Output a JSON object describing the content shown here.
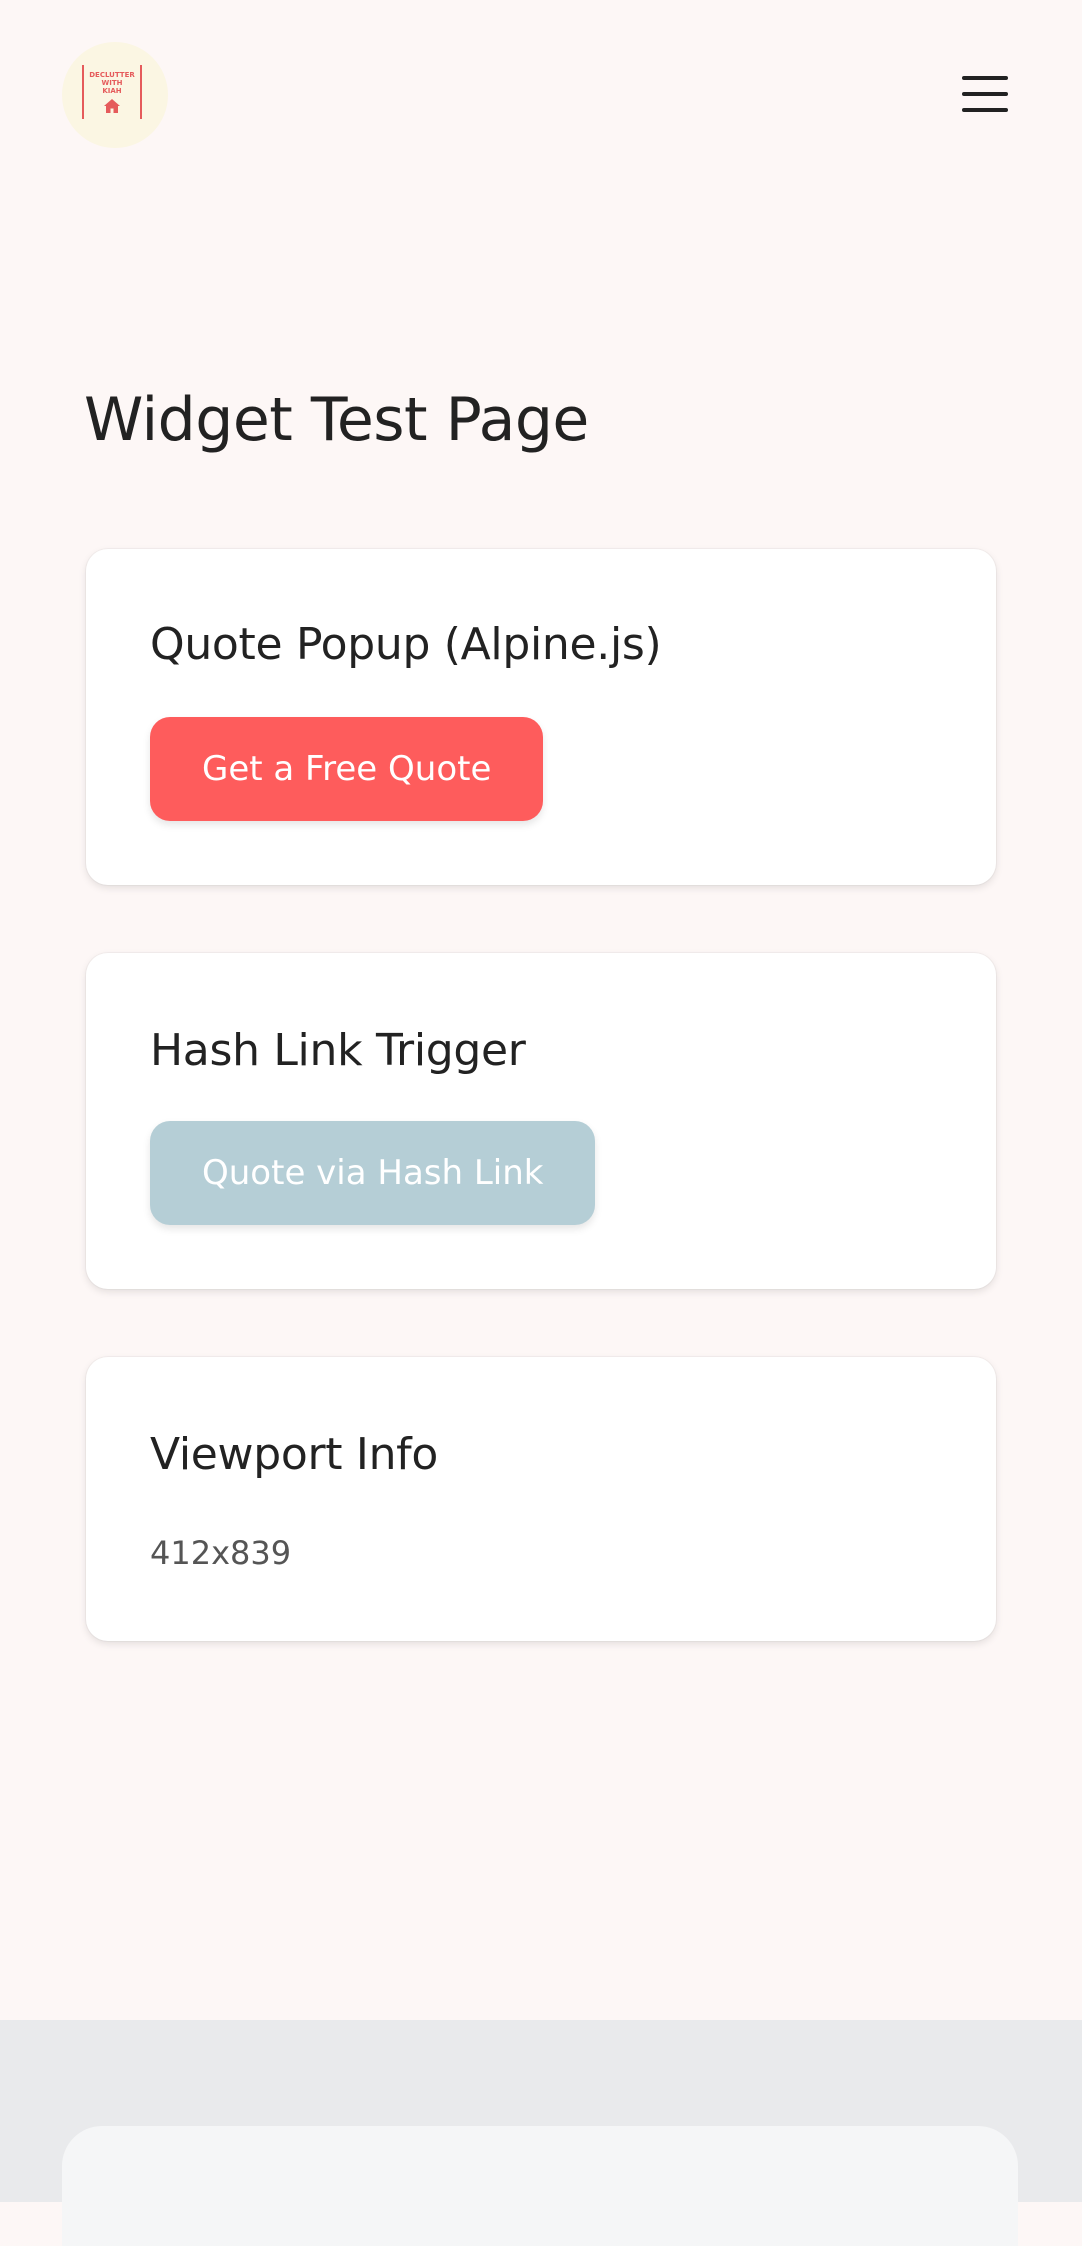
{
  "header": {
    "logo_text": "DECLUTTER\nWITH\nKIAH",
    "logo_icon": "house-icon",
    "menu_icon": "hamburger-menu-icon"
  },
  "page": {
    "title": "Widget Test Page"
  },
  "cards": [
    {
      "title": "Quote Popup (Alpine.js)",
      "button_label": "Get a Free Quote"
    },
    {
      "title": "Hash Link Trigger",
      "button_label": "Quote via Hash Link"
    },
    {
      "title": "Viewport Info",
      "value": "412x839"
    }
  ],
  "colors": {
    "background": "#fdf7f6",
    "primary_button": "#fe5c5c",
    "secondary_button": "#b5ced6",
    "card": "#ffffff",
    "footer": "#e9eaec",
    "logo_accent": "#e55b5b"
  }
}
